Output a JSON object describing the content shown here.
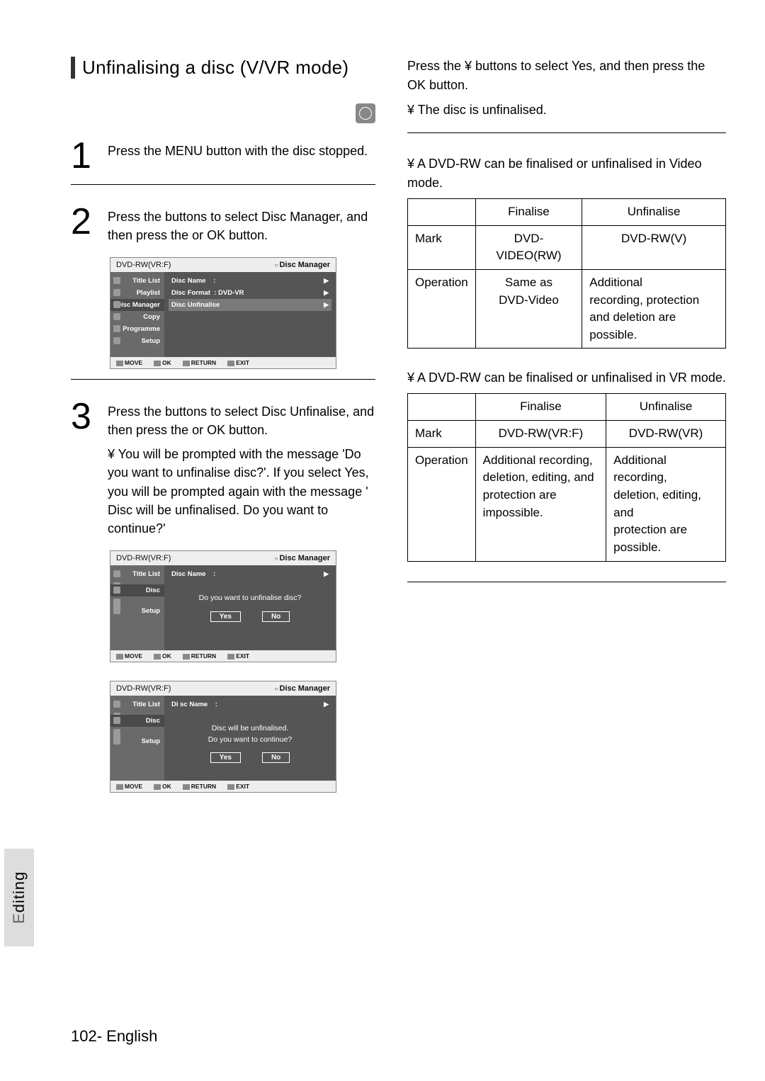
{
  "title": "Unfinalising a disc (V/VR mode)",
  "disc_badge": "DVD-RW",
  "steps": {
    "s1": {
      "num": "1",
      "text": "Press the MENU button with the disc stopped."
    },
    "s2": {
      "num": "2",
      "text": "Press the          buttons to select Disc Manager, and then press the       or OK  button."
    },
    "s3": {
      "num": "3",
      "text": "Press the           buttons to select Disc Unfinalise, and then press the       or OK  button.",
      "bullet": "¥ You will be prompted with the message 'Do you want to unfinalise disc?'. If you select Yes, you will be prompted again with the message ' Disc will be unfinalised. Do you want to continue?'"
    }
  },
  "osd_common": {
    "title_left": "DVD-RW(VR:F)",
    "title_right": "Disc Manager",
    "footer": {
      "move": "MOVE",
      "ok": "OK",
      "ret": "RETURN",
      "exit": "EXIT"
    }
  },
  "osd1": {
    "side": [
      "Title List",
      "Playlist",
      "Disc Manager",
      "Copy",
      "Programme",
      "Setup"
    ],
    "rows": [
      {
        "label": "Disc Name",
        "value": ":"
      },
      {
        "label": "Disc Format",
        "value": ": DVD-VR"
      },
      {
        "label": "Disc Unfinalise",
        "value": "",
        "hl": true
      }
    ]
  },
  "osd2": {
    "side_top": "Title List",
    "side_rest": [
      "",
      "",
      "Disc",
      "",
      "",
      "Setup"
    ],
    "row": {
      "label": "Disc Name",
      "value": ":"
    },
    "prompt": "Do you want to unfinalise disc?",
    "yes": "Yes",
    "no": "No"
  },
  "osd3": {
    "side_top": "Title List",
    "side_rest": [
      "",
      "",
      "Disc",
      "",
      "",
      "Setup"
    ],
    "row": {
      "label": "Di sc Name",
      "value": ":"
    },
    "prompt1": "Disc will be unfinalised.",
    "prompt2": "Do you want to continue?",
    "yes": "Yes",
    "no": "No"
  },
  "right": {
    "intro1": "Press the   ¥       buttons to select Yes, and then press the OK button.",
    "intro2": "¥ The disc is unfinalised.",
    "note1": "¥ A DVD-RW can be finalised or unfinalised in Video mode.",
    "table1": {
      "headers": [
        "",
        "Finalise",
        "Unfinalise"
      ],
      "rows": [
        [
          "Mark",
          "DVD-VIDEO(RW)",
          "DVD-RW(V)"
        ],
        [
          "Operation",
          "Same as\nDVD-Video",
          "Additional\nrecording, protection\nand deletion are possible."
        ]
      ]
    },
    "note2": "¥ A DVD-RW can be finalised or unfinalised in VR mode.",
    "table2": {
      "headers": [
        "",
        "Finalise",
        "Unfinalise"
      ],
      "rows": [
        [
          "Mark",
          "DVD-RW(VR:F)",
          "DVD-RW(VR)"
        ],
        [
          "Operation",
          "Additional recording,\ndeletion, editing, and\nprotection are impossible.",
          "Additional recording,\ndeletion, editing, and\nprotection are possible."
        ]
      ]
    }
  },
  "side_tab": "Editing",
  "footer": "102-  English"
}
